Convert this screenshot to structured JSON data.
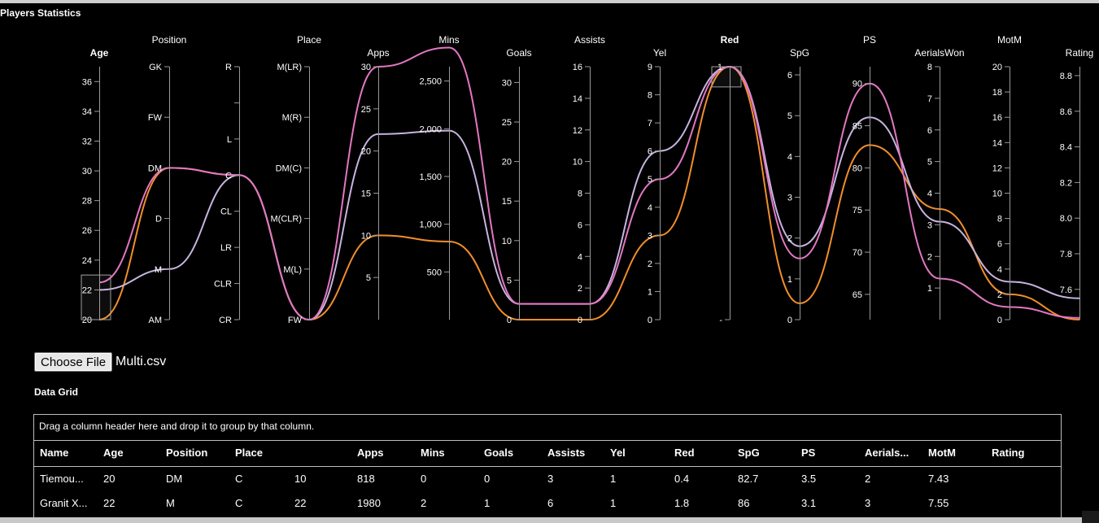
{
  "page": {
    "title": "Players Statistics"
  },
  "file_input": {
    "button_label": "Choose File",
    "file_name": "Multi.csv"
  },
  "grid": {
    "title": "Data Grid",
    "group_panel_text": "Drag a column header here and drop it to group by that column.",
    "columns": [
      "Name",
      "Age",
      "Position",
      "Place",
      "Apps",
      "Mins",
      "Goals",
      "Assists",
      "Yel",
      "Red",
      "SpG",
      "PS",
      "Aerials...",
      "MotM",
      "Rating"
    ],
    "rows": [
      [
        "Tiemou...",
        "20",
        "DM",
        "C",
        "10",
        "818",
        "0",
        "0",
        "3",
        "1",
        "0.4",
        "82.7",
        "3.5",
        "2",
        "7.43"
      ],
      [
        "Granit X...",
        "22",
        "M",
        "C",
        "22",
        "1980",
        "2",
        "1",
        "6",
        "1",
        "1.8",
        "86",
        "3.1",
        "3",
        "7.55"
      ]
    ]
  },
  "chart_data": {
    "type": "parallel-coordinates",
    "title": "",
    "axes": [
      {
        "key": "age",
        "label": "Age",
        "bold": true,
        "type": "linear",
        "domain": [
          20,
          37
        ],
        "ticks": [
          20,
          22,
          24,
          26,
          28,
          30,
          32,
          34,
          36
        ],
        "tick_labels": [
          "20",
          "22",
          "24",
          "26",
          "28",
          "30",
          "32",
          "34",
          "36"
        ]
      },
      {
        "key": "position",
        "label": "Position",
        "type": "ordinal",
        "categories": [
          "AM",
          "M",
          "D",
          "DM",
          "FW",
          "GK"
        ],
        "tick_labels": [
          "AM",
          "M",
          "D",
          "DM",
          "FW",
          "GK"
        ]
      },
      {
        "key": "position2",
        "label": "",
        "type": "ordinal",
        "categories": [
          "CR",
          "CLR",
          "LR",
          "CL",
          "C",
          "L",
          "",
          "R"
        ],
        "tick_labels": [
          "CR",
          "CLR",
          "LR",
          "CL",
          "C",
          "L",
          "",
          "R"
        ]
      },
      {
        "key": "place",
        "label": "Place",
        "type": "ordinal",
        "categories": [
          "FW",
          "M(L)",
          "M(CLR)",
          "DM(C)",
          "M(R)",
          "M(LR)"
        ],
        "tick_labels": [
          "FW",
          "M(L)",
          "M(CLR)",
          "DM(C)",
          "M(R)",
          "M(LR)"
        ]
      },
      {
        "key": "apps",
        "label": "Apps",
        "type": "linear",
        "domain": [
          0,
          30
        ],
        "ticks": [
          5,
          10,
          15,
          20,
          25,
          30
        ],
        "tick_labels": [
          "5",
          "10",
          "15",
          "20",
          "25",
          "30"
        ]
      },
      {
        "key": "mins",
        "label": "Mins",
        "type": "linear",
        "domain": [
          0,
          2650
        ],
        "ticks": [
          500,
          1000,
          1500,
          2000,
          2500
        ],
        "tick_labels": [
          "500",
          "1,000",
          "1,500",
          "2,000",
          "2,500"
        ]
      },
      {
        "key": "goals",
        "label": "Goals",
        "type": "linear",
        "domain": [
          0,
          32
        ],
        "ticks": [
          0,
          5,
          10,
          15,
          20,
          25,
          30
        ],
        "tick_labels": [
          "0",
          "5",
          "10",
          "15",
          "20",
          "25",
          "30"
        ]
      },
      {
        "key": "assists",
        "label": "Assists",
        "type": "linear",
        "domain": [
          0,
          16
        ],
        "ticks": [
          0,
          2,
          4,
          6,
          8,
          10,
          12,
          14,
          16
        ],
        "tick_labels": [
          "0",
          "2",
          "4",
          "6",
          "8",
          "10",
          "12",
          "14",
          "16"
        ]
      },
      {
        "key": "yel",
        "label": "Yel",
        "type": "linear",
        "domain": [
          0,
          9
        ],
        "ticks": [
          0,
          1,
          2,
          3,
          4,
          5,
          6,
          7,
          8,
          9
        ],
        "tick_labels": [
          "0",
          "1",
          "2",
          "3",
          "4",
          "5",
          "6",
          "7",
          "8",
          "9"
        ]
      },
      {
        "key": "red",
        "label": "Red",
        "bold": true,
        "type": "linear",
        "domain": [
          0,
          1
        ],
        "ticks": [
          0,
          1
        ],
        "tick_labels": [
          "-",
          "1"
        ]
      },
      {
        "key": "spg",
        "label": "SpG",
        "type": "linear",
        "domain": [
          0,
          6.2
        ],
        "ticks": [
          0,
          1,
          2,
          3,
          4,
          5,
          6
        ],
        "tick_labels": [
          "0",
          "1",
          "2",
          "3",
          "4",
          "5",
          "6"
        ]
      },
      {
        "key": "ps",
        "label": "PS",
        "type": "linear",
        "domain": [
          62,
          92
        ],
        "ticks": [
          65,
          70,
          75,
          80,
          85,
          90
        ],
        "tick_labels": [
          "65",
          "70",
          "75",
          "80",
          "85",
          "90"
        ]
      },
      {
        "key": "aerials",
        "label": "AerialsWon",
        "type": "linear",
        "domain": [
          0,
          8
        ],
        "ticks": [
          1,
          2,
          3,
          4,
          5,
          6,
          7,
          8
        ],
        "tick_labels": [
          "1",
          "2",
          "3",
          "4",
          "5",
          "6",
          "7",
          "8"
        ]
      },
      {
        "key": "motm",
        "label": "MotM",
        "type": "linear",
        "domain": [
          0,
          20
        ],
        "ticks": [
          0,
          2,
          4,
          6,
          8,
          10,
          12,
          14,
          16,
          18,
          20
        ],
        "tick_labels": [
          "0",
          "2",
          "4",
          "6",
          "8",
          "10",
          "12",
          "14",
          "16",
          "18",
          "20"
        ]
      },
      {
        "key": "rating",
        "label": "Rating",
        "type": "linear",
        "domain": [
          7.43,
          8.85
        ],
        "ticks": [
          7.6,
          7.8,
          8.0,
          8.2,
          8.4,
          8.6,
          8.8
        ],
        "tick_labels": [
          "7.6",
          "7.8",
          "8.0",
          "8.2",
          "8.4",
          "8.6",
          "8.8"
        ]
      }
    ],
    "series": [
      {
        "color": "#f28e2b",
        "values": {
          "age": 20,
          "position": "DM",
          "position2": "C",
          "place": "FW",
          "apps": 10,
          "mins": 818,
          "goals": 0,
          "assists": 0,
          "yel": 3,
          "red": 1,
          "spg": 0.4,
          "ps": 82.7,
          "aerials": 3.5,
          "motm": 2,
          "rating": 7.43
        }
      },
      {
        "color": "#c7b4e0",
        "values": {
          "age": 22,
          "position": "M",
          "position2": "C",
          "place": "FW",
          "apps": 22,
          "mins": 1980,
          "goals": 2,
          "assists": 1,
          "yel": 6,
          "red": 1,
          "spg": 1.8,
          "ps": 86,
          "aerials": 3.1,
          "motm": 3,
          "rating": 7.55
        }
      },
      {
        "color": "#e377c2",
        "values": {
          "age": 22.5,
          "position": "DM",
          "position2": "C",
          "place": "FW",
          "apps": 30,
          "mins": 2850,
          "goals": 2,
          "assists": 1,
          "yel": 5,
          "red": 1,
          "spg": 1.5,
          "ps": 90,
          "aerials": 1.3,
          "motm": 1,
          "rating": 7.44
        }
      }
    ],
    "brushes": [
      {
        "axis": "age",
        "range": [
          20,
          23
        ]
      },
      {
        "axis": "red",
        "range": [
          0.92,
          1
        ]
      }
    ],
    "grid": false,
    "legend": "none"
  }
}
